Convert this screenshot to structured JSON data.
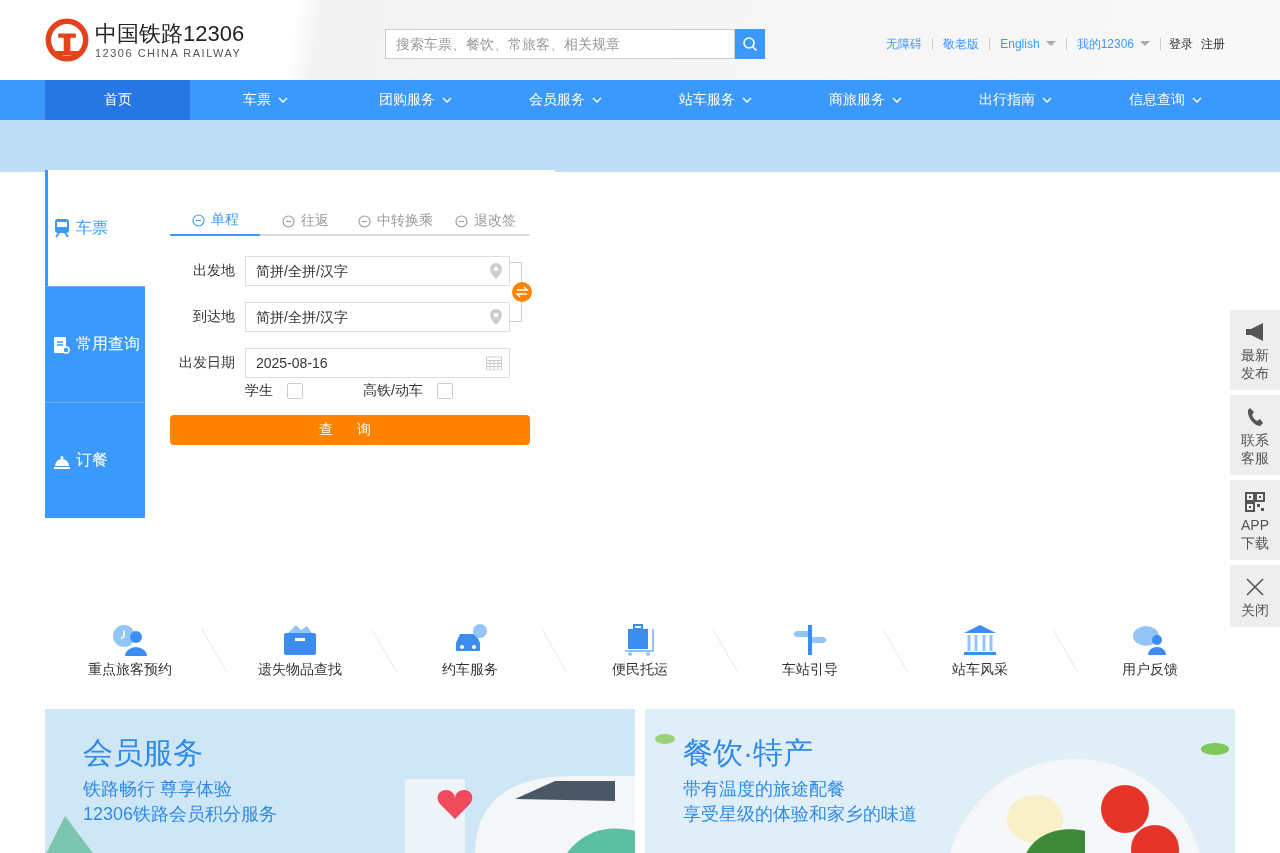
{
  "logo": {
    "name": "中国铁路12306",
    "subtitle": "12306 CHINA RAILWAY"
  },
  "search": {
    "placeholder": "搜索车票、餐饮、常旅客、相关规章"
  },
  "top_links": [
    {
      "label": "无障碍",
      "kind": "link",
      "dropdown": false
    },
    {
      "label": "敬老版",
      "kind": "link",
      "dropdown": false
    },
    {
      "label": "English",
      "kind": "link",
      "dropdown": true
    },
    {
      "label": "我的12306",
      "kind": "link",
      "dropdown": true
    },
    {
      "label": "登录",
      "kind": "account",
      "dropdown": false
    },
    {
      "label": "注册",
      "kind": "account",
      "dropdown": false
    }
  ],
  "nav": [
    {
      "label": "首页",
      "selected": true,
      "dropdown": false
    },
    {
      "label": "车票",
      "selected": false,
      "dropdown": true
    },
    {
      "label": "团购服务",
      "selected": false,
      "dropdown": true
    },
    {
      "label": "会员服务",
      "selected": false,
      "dropdown": true
    },
    {
      "label": "站车服务",
      "selected": false,
      "dropdown": true
    },
    {
      "label": "商旅服务",
      "selected": false,
      "dropdown": true
    },
    {
      "label": "出行指南",
      "selected": false,
      "dropdown": true
    },
    {
      "label": "信息查询",
      "selected": false,
      "dropdown": true
    }
  ],
  "booking": {
    "side_tabs": [
      {
        "label": "车票",
        "selected": true
      },
      {
        "label": "常用查询",
        "selected": false
      },
      {
        "label": "订餐",
        "selected": false
      }
    ],
    "trip_tabs": [
      {
        "label": "单程",
        "selected": true
      },
      {
        "label": "往返",
        "selected": false
      },
      {
        "label": "中转换乘",
        "selected": false
      },
      {
        "label": "退改签",
        "selected": false
      }
    ],
    "fields": [
      {
        "label": "出发地",
        "kind": "station",
        "placeholder": "简拼/全拼/汉字"
      },
      {
        "label": "到达地",
        "kind": "station",
        "placeholder": "简拼/全拼/汉字"
      },
      {
        "label": "出发日期",
        "kind": "date",
        "value": "2025-08-16"
      }
    ],
    "options": [
      {
        "label": "学生",
        "checked": false
      },
      {
        "label": "高铁/动车",
        "checked": false
      }
    ],
    "submit": "查 询"
  },
  "services": [
    {
      "label": "重点旅客预约"
    },
    {
      "label": "遗失物品查找"
    },
    {
      "label": "约车服务"
    },
    {
      "label": "便民托运"
    },
    {
      "label": "车站引导"
    },
    {
      "label": "站车风采"
    },
    {
      "label": "用户反馈"
    }
  ],
  "float_bar": [
    {
      "lines": [
        "最新",
        "发布"
      ]
    },
    {
      "lines": [
        "联系",
        "客服"
      ]
    },
    {
      "lines": [
        "APP",
        "下载"
      ]
    },
    {
      "lines": [
        "关闭"
      ]
    }
  ],
  "banners": [
    {
      "title": "会员服务",
      "lines": [
        "铁路畅行 尊享体验",
        "12306铁路会员积分服务"
      ],
      "kind": "picture"
    },
    {
      "title": "餐饮·特产",
      "lines": [
        "带有温度的旅途配餐",
        "享受星级的体验和家乡的味道"
      ],
      "kind": "picture"
    }
  ]
}
